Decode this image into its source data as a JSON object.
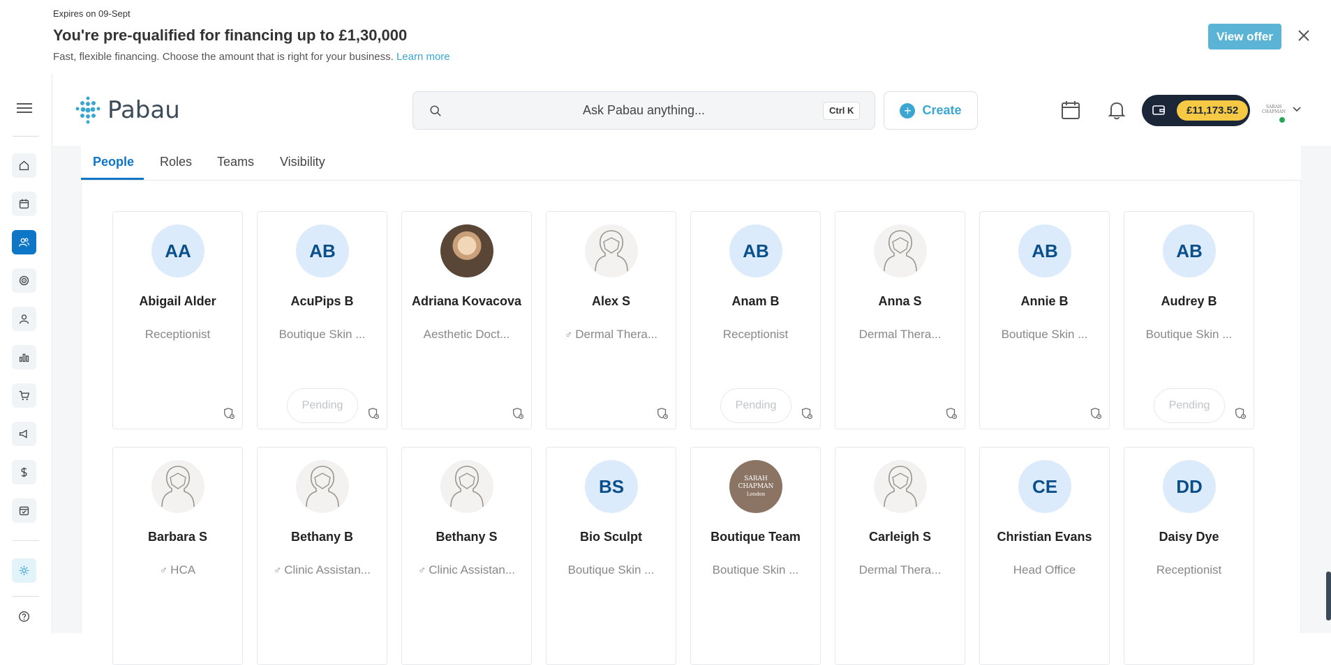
{
  "banner": {
    "expires": "Expires on 09-Sept",
    "headline": "You're pre-qualified for financing up to £1,30,000",
    "subtext": "Fast, flexible financing. Choose the amount that is right for your business.",
    "learn_more": "Learn more",
    "view_offer": "View offer"
  },
  "header": {
    "logo_name": "Pabau",
    "search_placeholder": "Ask Pabau anything...",
    "shortcut": "Ctrl K",
    "create_label": "Create",
    "wallet_amount": "£11,173.52",
    "avatar_text": "SARAH CHAPMAN"
  },
  "tabs": [
    "People",
    "Roles",
    "Teams",
    "Visibility"
  ],
  "people": [
    {
      "name": "Abigail Alder",
      "role": "Receptionist",
      "initials": "AA",
      "avatar": "initials",
      "pending": ""
    },
    {
      "name": "AcuPips B",
      "role": "Boutique Skin ...",
      "initials": "AB",
      "avatar": "initials",
      "pending": "Pending"
    },
    {
      "name": "Adriana Kovacova",
      "role": "Aesthetic Doct...",
      "initials": "",
      "avatar": "photo",
      "pending": ""
    },
    {
      "name": "Alex S",
      "role": "Dermal Thera...",
      "initials": "",
      "avatar": "ghost",
      "pending": "",
      "symbol": "♂"
    },
    {
      "name": "Anam B",
      "role": "Receptionist",
      "initials": "AB",
      "avatar": "initials",
      "pending": "Pending"
    },
    {
      "name": "Anna S",
      "role": "Dermal Thera...",
      "initials": "",
      "avatar": "ghost",
      "pending": ""
    },
    {
      "name": "Annie B",
      "role": "Boutique Skin ...",
      "initials": "AB",
      "avatar": "initials",
      "pending": ""
    },
    {
      "name": "Audrey B",
      "role": "Boutique Skin ...",
      "initials": "AB",
      "avatar": "initials",
      "pending": "Pending"
    },
    {
      "name": "Barbara S",
      "role": "HCA",
      "initials": "",
      "avatar": "ghost",
      "pending": "",
      "symbol": "♂"
    },
    {
      "name": "Bethany B",
      "role": "Clinic Assistan...",
      "initials": "",
      "avatar": "ghost",
      "pending": "",
      "symbol": "♂"
    },
    {
      "name": "Bethany S",
      "role": "Clinic Assistan...",
      "initials": "",
      "avatar": "ghost",
      "pending": "",
      "symbol": "♂"
    },
    {
      "name": "Bio Sculpt",
      "role": "Boutique Skin ...",
      "initials": "BS",
      "avatar": "initials",
      "pending": ""
    },
    {
      "name": "Boutique Team",
      "role": "Boutique Skin ...",
      "initials": "",
      "avatar": "brand",
      "pending": ""
    },
    {
      "name": "Carleigh S",
      "role": "Dermal Thera...",
      "initials": "",
      "avatar": "ghost",
      "pending": ""
    },
    {
      "name": "Christian Evans",
      "role": "Head Office",
      "initials": "CE",
      "avatar": "initials",
      "pending": ""
    },
    {
      "name": "Daisy Dye",
      "role": "Receptionist",
      "initials": "DD",
      "avatar": "initials",
      "pending": ""
    }
  ],
  "brand_avatar_text": [
    "SARAH",
    "CHAPMAN",
    "London"
  ],
  "colors": {
    "accent": "#0e76c7",
    "link": "#3aa7d3",
    "wallet_bg": "#1c2639",
    "wallet_amount_bg": "#f6c945",
    "initials_bg": "#dcebfb"
  }
}
